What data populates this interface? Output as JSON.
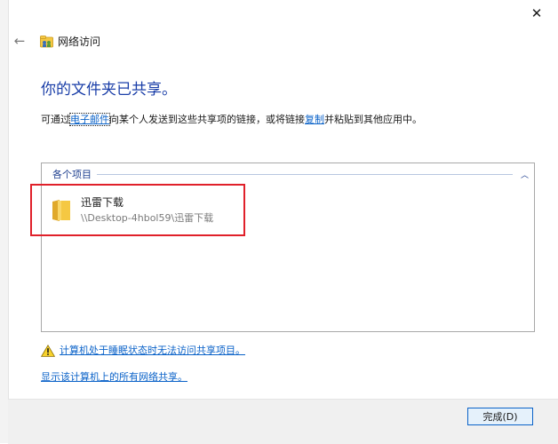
{
  "window": {
    "title": "网络访问",
    "close_glyph": "✕",
    "back_glyph": "←"
  },
  "main": {
    "heading": "你的文件夹已共享。",
    "desc_before": "可通过",
    "email_link": "电子邮件",
    "desc_middle": "向某个人发送到这些共享项的链接，或将链接",
    "copy_link": "复制",
    "desc_after": "并粘贴到其他应用中。"
  },
  "items_group": {
    "label": "各个项目",
    "chevron": "︿",
    "items": [
      {
        "name": "迅雷下载",
        "path": "\\\\Desktop-4hbol59\\迅雷下载",
        "icon": "folder-icon"
      }
    ]
  },
  "links": {
    "warning": "计算机处于睡眠状态时无法访问共享项目。",
    "all_shares": "显示该计算机上的所有网络共享。"
  },
  "footer": {
    "finish_label": "完成(D)"
  },
  "colors": {
    "heading": "#1a3ea8",
    "link": "#0a62c8",
    "highlight": "#e0202a",
    "folder": "#f5c842"
  }
}
